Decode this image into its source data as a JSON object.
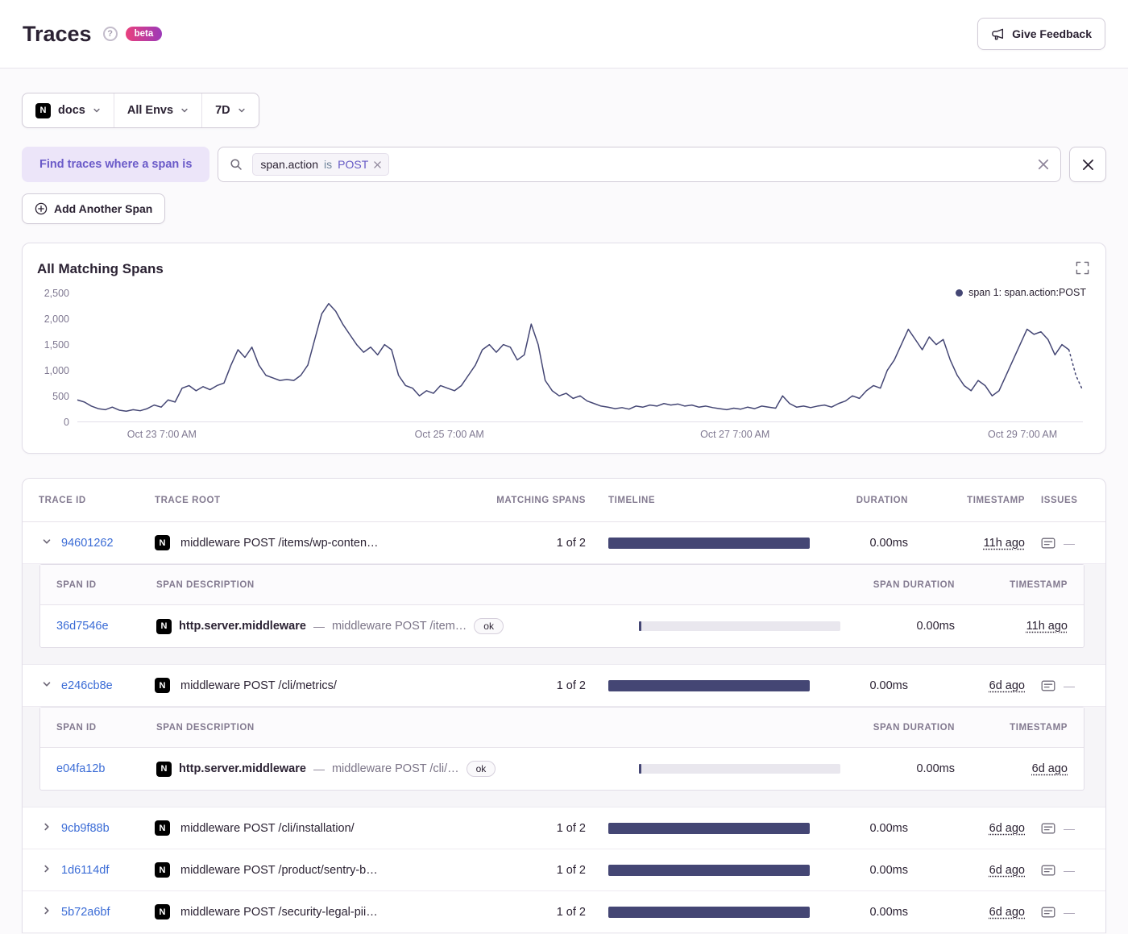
{
  "colors": {
    "timeline_bar": "#444674",
    "accent": "#6c5fc7",
    "link": "#3b6cd6"
  },
  "header": {
    "title": "Traces",
    "help": "?",
    "beta": "beta",
    "feedback": "Give Feedback"
  },
  "filters": {
    "project_icon": "N",
    "project": "docs",
    "environment": "All Envs",
    "range": "7D"
  },
  "search": {
    "builder_label": "Find traces where a span is",
    "token_key": "span.action",
    "token_op": "is",
    "token_value": "POST",
    "add_span": "Add Another Span"
  },
  "chart": {
    "title": "All Matching Spans",
    "legend": "span 1: span.action:POST"
  },
  "chart_data": {
    "type": "line",
    "title": "All Matching Spans",
    "legend_position": "top-right",
    "grid": false,
    "ylim": [
      0,
      2500
    ],
    "y_ticks": [
      "0",
      "500",
      "1,000",
      "1,500",
      "2,000",
      "2,500"
    ],
    "x_ticks": [
      "Oct 23 7:00 AM",
      "Oct 25 7:00 AM",
      "Oct 27 7:00 AM",
      "Oct 29 7:00 AM"
    ],
    "x_tick_positions": [
      0.084,
      0.37,
      0.654,
      0.94
    ],
    "line_color": "#444674",
    "series": [
      {
        "name": "span 1: span.action:POST",
        "values": [
          420,
          380,
          300,
          250,
          230,
          280,
          220,
          200,
          230,
          210,
          250,
          320,
          280,
          420,
          380,
          650,
          700,
          600,
          680,
          620,
          700,
          750,
          1100,
          1400,
          1250,
          1450,
          1100,
          900,
          850,
          800,
          820,
          800,
          900,
          1100,
          1600,
          2100,
          2300,
          2150,
          1900,
          1700,
          1500,
          1350,
          1450,
          1300,
          1500,
          1400,
          900,
          700,
          650,
          500,
          600,
          550,
          700,
          650,
          600,
          700,
          900,
          1100,
          1400,
          1500,
          1350,
          1500,
          1450,
          1200,
          1300,
          1900,
          1500,
          800,
          600,
          500,
          550,
          450,
          500,
          400,
          350,
          300,
          280,
          250,
          270,
          240,
          300,
          280,
          320,
          300,
          350,
          320,
          340,
          300,
          320,
          280,
          300,
          270,
          250,
          230,
          260,
          240,
          280,
          250,
          300,
          280,
          260,
          500,
          350,
          280,
          300,
          270,
          300,
          320,
          280,
          350,
          400,
          500,
          450,
          600,
          700,
          650,
          1000,
          1200,
          1500,
          1800,
          1600,
          1400,
          1650,
          1500,
          1600,
          1200,
          900,
          700,
          600,
          800,
          700,
          500,
          600,
          900,
          1200,
          1500,
          1800,
          1700,
          1750,
          1600,
          1300,
          1500,
          1400,
          900,
          600
        ]
      }
    ]
  },
  "table": {
    "columns": [
      "Trace ID",
      "Trace Root",
      "Matching Spans",
      "Timeline",
      "Duration",
      "Timestamp",
      "Issues"
    ],
    "span_columns": [
      "Span ID",
      "Span Description",
      "Span Duration",
      "Timestamp"
    ],
    "desc_separator": "—",
    "rows": [
      {
        "trace_id": "94601262",
        "root": "middleware POST /items/wp-conten…",
        "matching": "1 of 2",
        "duration": "0.00ms",
        "timestamp": "11h ago",
        "issues": "—",
        "spans": [
          {
            "span_id": "36d7546e",
            "op": "http.server.middleware",
            "description": "middleware POST /item…",
            "status": "ok",
            "duration": "0.00ms",
            "timestamp": "11h ago"
          }
        ]
      },
      {
        "trace_id": "e246cb8e",
        "root": "middleware POST /cli/metrics/",
        "matching": "1 of 2",
        "duration": "0.00ms",
        "timestamp": "6d ago",
        "issues": "—",
        "spans": [
          {
            "span_id": "e04fa12b",
            "op": "http.server.middleware",
            "description": "middleware POST /cli/…",
            "status": "ok",
            "duration": "0.00ms",
            "timestamp": "6d ago"
          }
        ]
      },
      {
        "trace_id": "9cb9f88b",
        "root": "middleware POST /cli/installation/",
        "matching": "1 of 2",
        "duration": "0.00ms",
        "timestamp": "6d ago",
        "issues": "—"
      },
      {
        "trace_id": "1d6114df",
        "root": "middleware POST /product/sentry-b…",
        "matching": "1 of 2",
        "duration": "0.00ms",
        "timestamp": "6d ago",
        "issues": "—"
      },
      {
        "trace_id": "5b72a6bf",
        "root": "middleware POST /security-legal-pii…",
        "matching": "1 of 2",
        "duration": "0.00ms",
        "timestamp": "6d ago",
        "issues": "—"
      }
    ]
  }
}
